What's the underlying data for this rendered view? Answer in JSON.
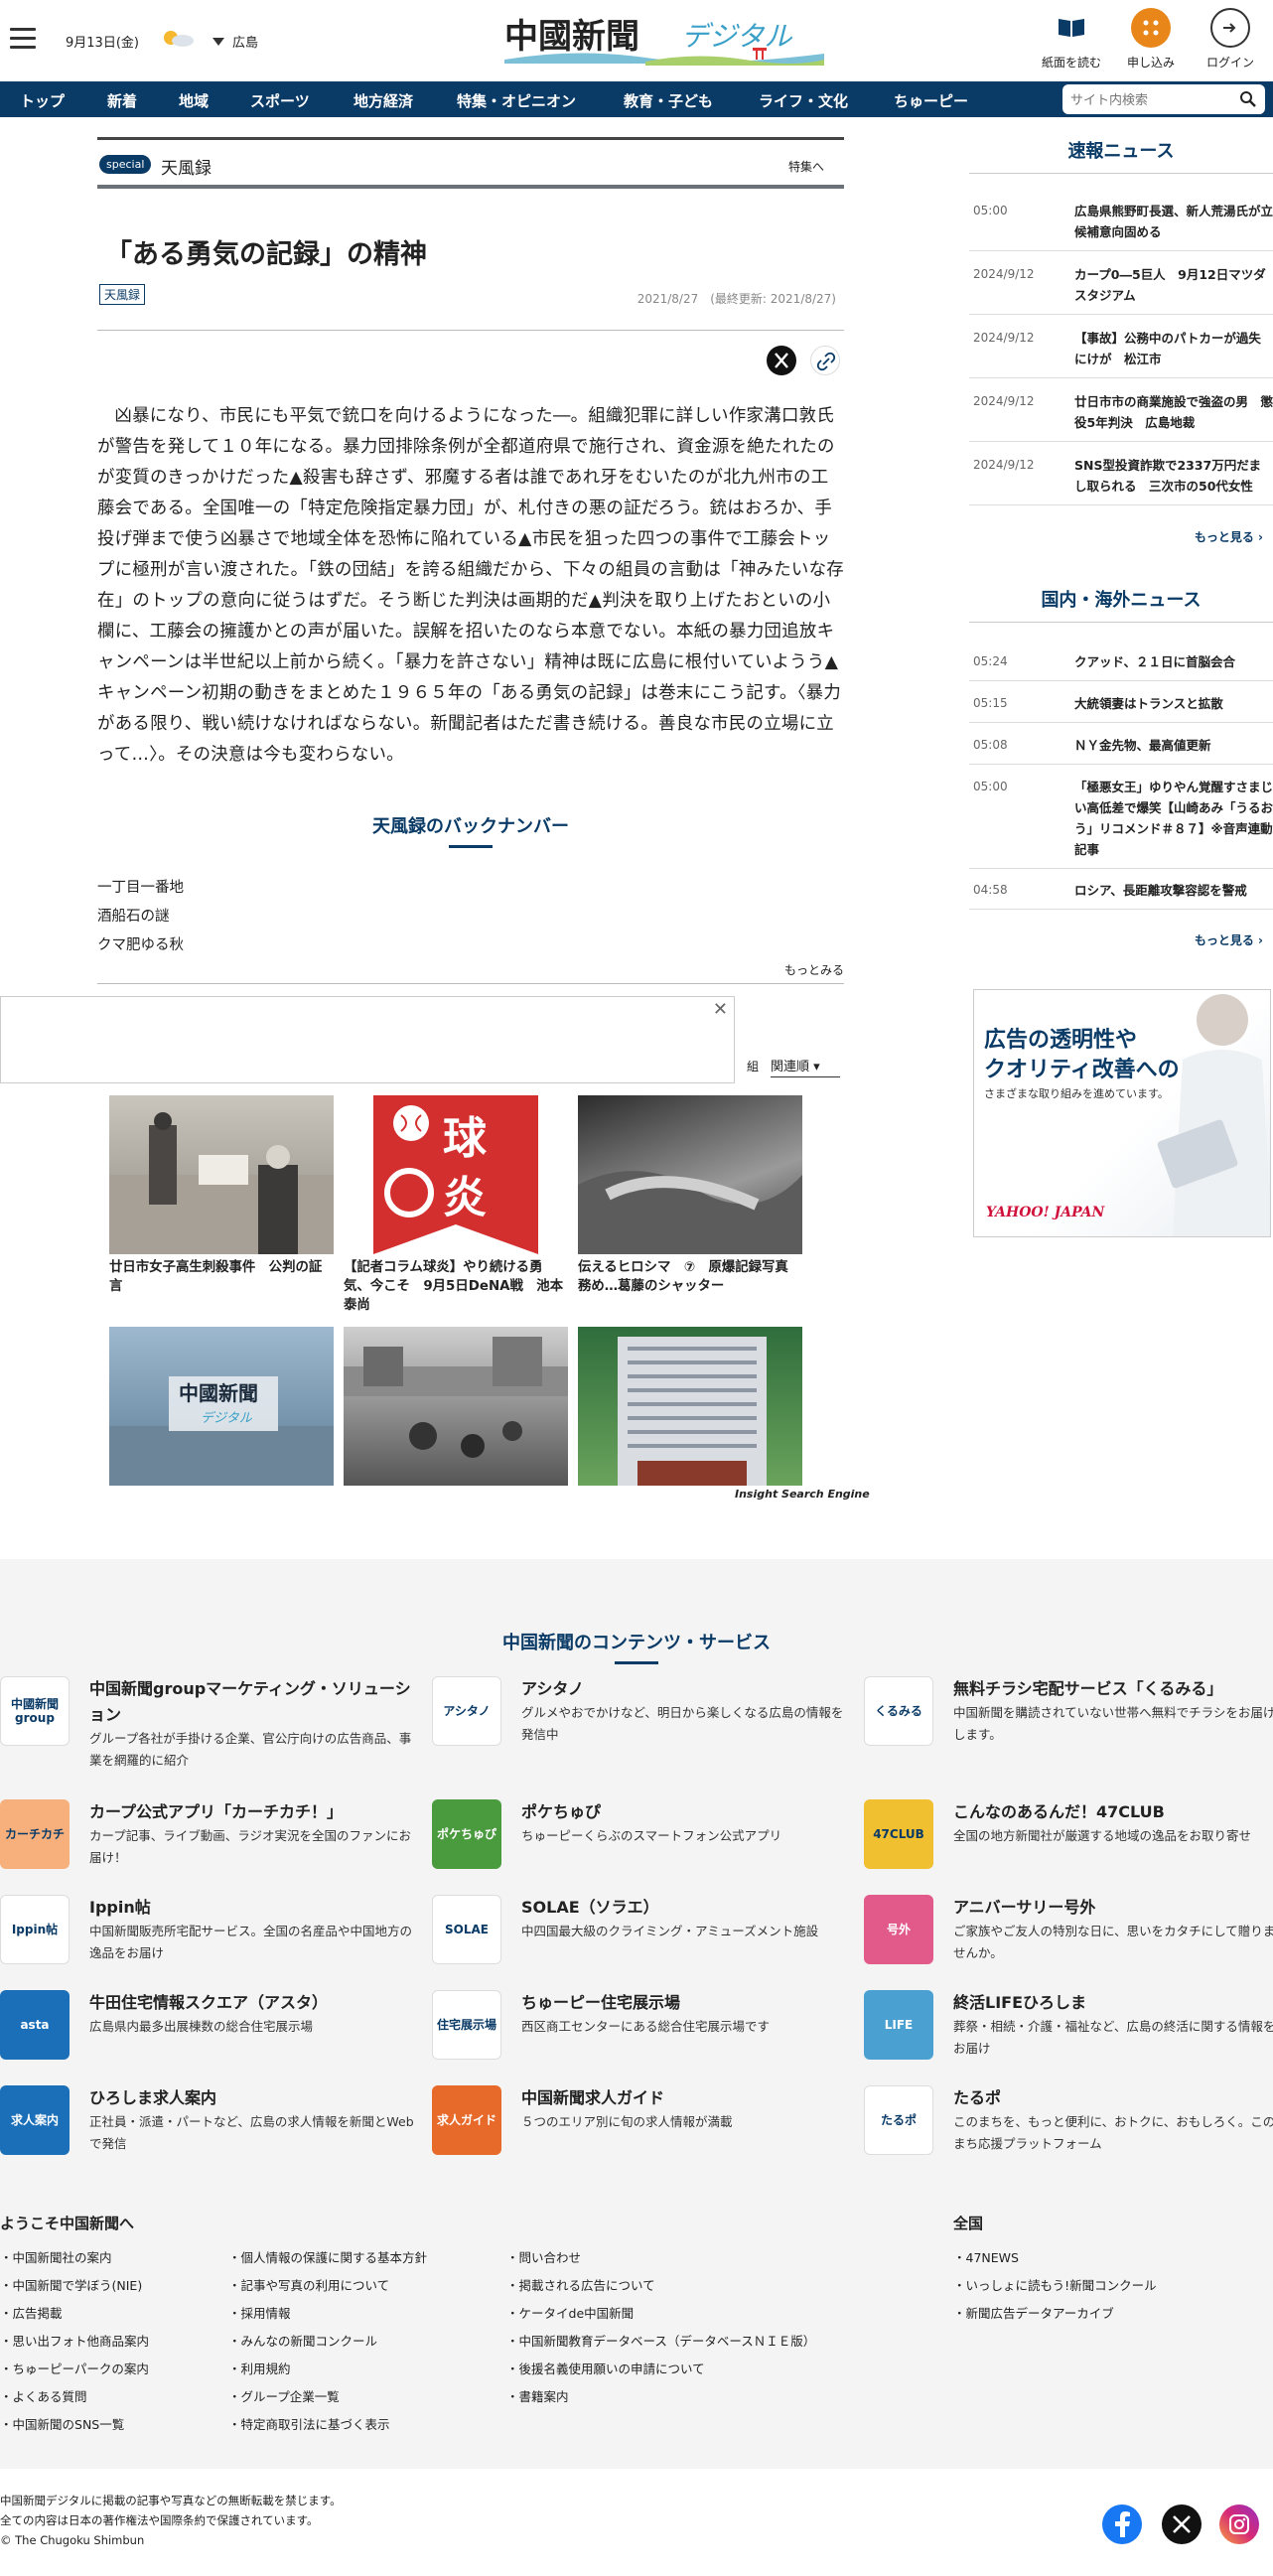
{
  "header": {
    "date": "9月13日(金)",
    "area": "広島",
    "logo_text": "中國新聞",
    "logo_sub": "デジタル",
    "icons": [
      {
        "label": "紙面を読む",
        "icon": "newspaper-icon"
      },
      {
        "label": "申し込み",
        "icon": "apply-icon"
      },
      {
        "label": "ログイン",
        "icon": "login-icon"
      }
    ]
  },
  "nav": {
    "items": [
      "トップ",
      "新着",
      "地域",
      "スポーツ",
      "地方経済",
      "特集・オピニオン",
      "教育・子ども",
      "ライフ・文化",
      "ちゅーピー"
    ],
    "search_placeholder": "サイト内検索"
  },
  "section": {
    "badge": "special",
    "title": "天風録",
    "link": "特集へ"
  },
  "article": {
    "title": "「ある勇気の記録」の精神",
    "tag": "天風録",
    "date": "2021/8/27",
    "updated": "(最終更新: 2021/8/27)",
    "body": "凶暴になり、市民にも平気で銃口を向けるようになった―。組織犯罪に詳しい作家溝口敦氏が警告を発して１０年になる。暴力団排除条例が全都道府県で施行され、資金源を絶たれたのが変質のきっかけだった▲殺害も辞さず、邪魔する者は誰であれ牙をむいたのが北九州市の工藤会である。全国唯一の「特定危険指定暴力団」が、札付きの悪の証だろう。銃はおろか、手投げ弾まで使う凶暴さで地域全体を恐怖に陥れている▲市民を狙った四つの事件で工藤会トップに極刑が言い渡された。「鉄の団結」を誇る組織だから、下々の組員の言動は「神みたいな存在」のトップの意向に従うはずだ。そう断じた判決は画期的だ▲判決を取り上げたおといの小欄に、工藤会の擁護かとの声が届いた。誤解を招いたのなら本意でない。本紙の暴力団追放キャンペーンは半世紀以上前から続く。「暴力を許さない」精神は既に広島に根付いていようう▲キャンペーン初期の動きをまとめた１９６５年の「ある勇気の記録」は巻末にこう記す。〈暴力がある限り、戦い続けなければならない。新聞記者はただ書き続ける。善良な市民の立場に立って…〉。その決意は今も変わらない。"
  },
  "backnumbers": {
    "heading": "天風録のバックナンバー",
    "items": [
      "一丁目一番地",
      "酒船石の謎",
      "クマ肥ゆる秋"
    ],
    "more": "もっとみる"
  },
  "related": {
    "sort_prefix": "組",
    "sort": "関連順",
    "cards": [
      {
        "caption": "廿日市女子高生刺殺事件　公判の証言"
      },
      {
        "caption": "【記者コラム球炎】やり続ける勇気、今こそ　9月5日DeNA戦　池本泰尚"
      },
      {
        "caption": "伝えるヒロシマ　⑦　原爆記録写真　務め…葛藤のシャッター"
      },
      {
        "caption": ""
      },
      {
        "caption": ""
      },
      {
        "caption": ""
      }
    ],
    "engine": "Insight Search Engine"
  },
  "sidebar": {
    "breaking": {
      "heading": "速報ニュース",
      "more": "もっと見る",
      "items": [
        {
          "time": "05:00",
          "text": "広島県熊野町長選、新人荒湯氏が立候補意向固める"
        },
        {
          "time": "2024/9/12",
          "text": "カープ0―5巨人　9月12日マツダスタジアム"
        },
        {
          "time": "2024/9/12",
          "text": "【事故】公務中のパトカーが過失にけが　松江市"
        },
        {
          "time": "2024/9/12",
          "text": "廿日市市の商業施設で強盗の男　懲役5年判決　広島地裁"
        },
        {
          "time": "2024/9/12",
          "text": "SNS型投資詐欺で2337万円だまし取られる　三次市の50代女性"
        }
      ]
    },
    "world": {
      "heading": "国内・海外ニュース",
      "more": "もっと見る",
      "items": [
        {
          "time": "05:24",
          "text": "クアッド、２１日に首脳会合"
        },
        {
          "time": "05:15",
          "text": "大統領妻はトランスと拡散"
        },
        {
          "time": "05:08",
          "text": "ＮＹ金先物、最高値更新"
        },
        {
          "time": "05:00",
          "text": "「極悪女王」ゆりやん覚醒すさまじい高低差で爆笑【山崎あみ「うるおう」リコメンド＃８７】※音声連動記事"
        },
        {
          "time": "04:58",
          "text": "ロシア、長距離攻撃容認を警戒"
        }
      ]
    },
    "ad": {
      "line1": "広告の透明性や",
      "line2": "クオリティ改善への",
      "line3": "さまざまな取り組みを進めています。",
      "brand": "YAHOO! JAPAN"
    }
  },
  "footer": {
    "heading": "中国新聞のコンテンツ・サービス",
    "services": [
      {
        "title": "中国新聞groupマーケティング・ソリューション",
        "desc": "グループ各社が手掛ける企業、官公庁向けの広告商品、事業を網羅的に紹介",
        "icon": "中國新聞group",
        "color": "#ffffff"
      },
      {
        "title": "アシタノ",
        "desc": "グルメやおでかけなど、明日から楽しくなる広島の情報を発信中",
        "icon": "アシタノ",
        "color": "#ffffff"
      },
      {
        "title": "無料チラシ宅配サービス「くるみる」",
        "desc": "中国新聞を購読されていない世帯へ無料でチラシをお届けします。",
        "icon": "くるみる",
        "color": "#ffffff"
      },
      {
        "title": "カープ公式アプリ「カーチカチ！」",
        "desc": "カープ記事、ライブ動画、ラジオ実況を全国のファンにお届け！",
        "icon": "カーチカチ",
        "color": "#f7b07c"
      },
      {
        "title": "ポケちゅぴ",
        "desc": "ちゅーピーくらぶのスマートフォン公式アプリ",
        "icon": "ポケちゅぴ",
        "color": "#4a9a3e"
      },
      {
        "title": "こんなのあるんだ！47CLUB",
        "desc": "全国の地方新聞社が厳選する地域の逸品をお取り寄せ",
        "icon": "47CLUB",
        "color": "#f0c030"
      },
      {
        "title": "Ippin帖",
        "desc": "中国新聞販売所宅配サービス。全国の名産品や中国地方の逸品をお届け",
        "icon": "Ippin帖",
        "color": "#ffffff"
      },
      {
        "title": "SOLAE（ソラエ）",
        "desc": "中四国最大級のクライミング・アミューズメント施設",
        "icon": "SOLAE",
        "color": "#ffffff"
      },
      {
        "title": "アニバーサリー号外",
        "desc": "ご家族やご友人の特別な日に、思いをカタチにして贈りませんか。",
        "icon": "号外",
        "color": "#e25a8a"
      },
      {
        "title": "牛田住宅情報スクエア（アスタ）",
        "desc": "広島県内最多出展棟数の総合住宅展示場",
        "icon": "asta",
        "color": "#1a6fb8"
      },
      {
        "title": "ちゅーピー住宅展示場",
        "desc": "西区商工センターにある総合住宅展示場です",
        "icon": "住宅展示場",
        "color": "#ffffff"
      },
      {
        "title": "終活LIFEひろしま",
        "desc": "葬祭・相続・介護・福祉など、広島の終活に関する情報をお届け",
        "icon": "LIFE",
        "color": "#4aa0d0"
      },
      {
        "title": "ひろしま求人案内",
        "desc": "正社員・派遣・パートなど、広島の求人情報を新聞とWebで発信",
        "icon": "求人案内",
        "color": "#1a6fb8"
      },
      {
        "title": "中国新聞求人ガイド",
        "desc": "５つのエリア別に旬の求人情報が満載",
        "icon": "求人ガイド",
        "color": "#e86a2a"
      },
      {
        "title": "たるポ",
        "desc": "このまちを、もっと便利に、おトクに、おもしろく。このまち応援プラットフォーム",
        "icon": "たるポ",
        "color": "#ffffff"
      }
    ],
    "welcome": {
      "heading": "ようこそ中国新聞へ",
      "col1": [
        "中国新聞社の案内",
        "中国新聞で学ぼう(NIE)",
        "広告掲載",
        "思い出フォト他商品案内",
        "ちゅーピーパークの案内",
        "よくある質問",
        "中国新聞のSNS一覧"
      ],
      "col2": [
        "個人情報の保護に関する基本方針",
        "記事や写真の利用について",
        "採用情報",
        "みんなの新聞コンクール",
        "利用規約",
        "グループ企業一覧",
        "特定商取引法に基づく表示"
      ],
      "col3": [
        "問い合わせ",
        "掲載される広告について",
        "ケータイde中国新聞",
        "中国新聞教育データベース（データベースＮＩＥ版）",
        "後援名義使用願いの申請について",
        "書籍案内"
      ]
    },
    "national": {
      "heading": "全国",
      "items": [
        "47NEWS",
        "いっしょに読もう!新聞コンクール",
        "新聞広告データアーカイブ"
      ]
    },
    "copyright": [
      "中国新聞デジタルに掲載の記事や写真などの無断転載を禁じます。",
      "全ての内容は日本の著作権法や国際条約で保護されています。",
      "© The Chugoku Shimbun"
    ],
    "social": [
      "facebook-icon",
      "x-icon",
      "instagram-icon"
    ]
  },
  "colors": {
    "navy": "#0a3a66",
    "accent": "#e8861a"
  }
}
